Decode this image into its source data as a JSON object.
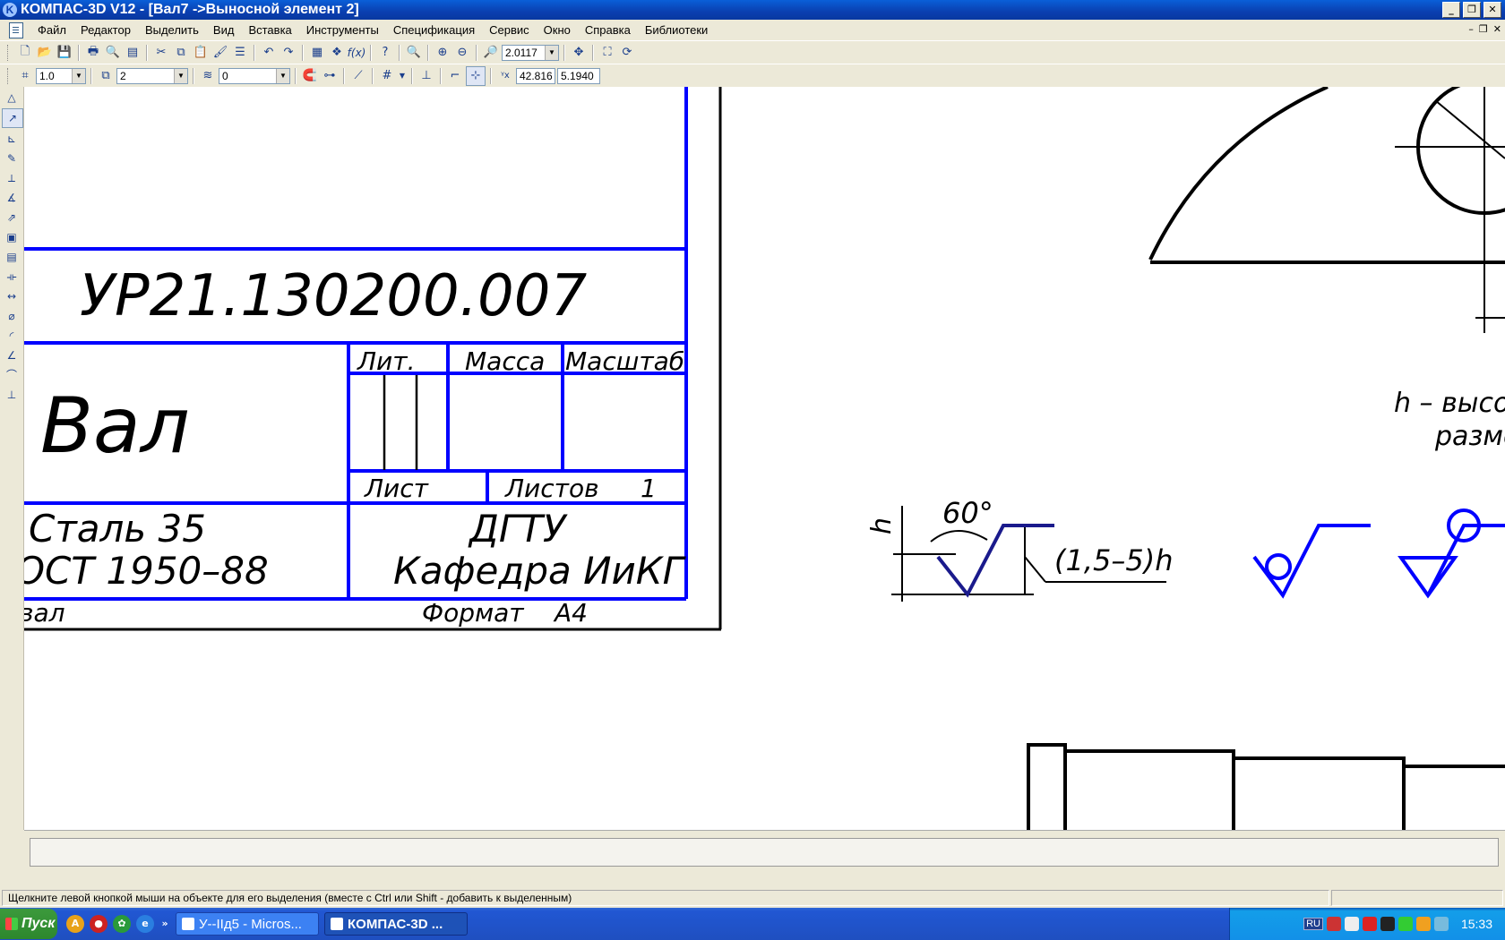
{
  "window": {
    "title": "КОМПАС-3D V12 - [Вал7 ->Выносной элемент 2]"
  },
  "menu": [
    "Файл",
    "Редактор",
    "Выделить",
    "Вид",
    "Вставка",
    "Инструменты",
    "Спецификация",
    "Сервис",
    "Окно",
    "Справка",
    "Библиотеки"
  ],
  "toolbar1": {
    "zoom_value": "2.0117"
  },
  "toolbar2": {
    "step_value": "1.0",
    "layer_value": "2",
    "view_value": "0",
    "coord_x": "42.816",
    "coord_y": "5.1940"
  },
  "drawing": {
    "designation": "УР21.130200.007",
    "part_name": "Вал",
    "hdr_lit": "Лит.",
    "hdr_mass": "Масса",
    "hdr_scale": "Масштаб",
    "sheet_label": "Лист",
    "sheets_label": "Листов",
    "sheets_count": "1",
    "material_line1": "Сталь 35",
    "material_line2": "ОСТ 1950–88",
    "org_line1": "ДГТУ",
    "org_line2": "Кафедра ИиКГ",
    "bottom_left": "вал",
    "format_label": "Формат",
    "format_value": "А4",
    "angle_label": "60°",
    "h_label": "h",
    "height_label": "(1,5–5)h",
    "note_line1": "h – высо",
    "note_line2": "разме"
  },
  "status": {
    "message": "Щелкните левой кнопкой мыши на объекте для его выделения (вместе с Ctrl или Shift - добавить к выделенным)"
  },
  "taskbar": {
    "start_label": "Пуск",
    "tasks": [
      {
        "label": "У--IIд5 - Micros..."
      },
      {
        "label": "КОМПАС-3D ..."
      }
    ],
    "lang": "RU",
    "clock": "15:33"
  }
}
